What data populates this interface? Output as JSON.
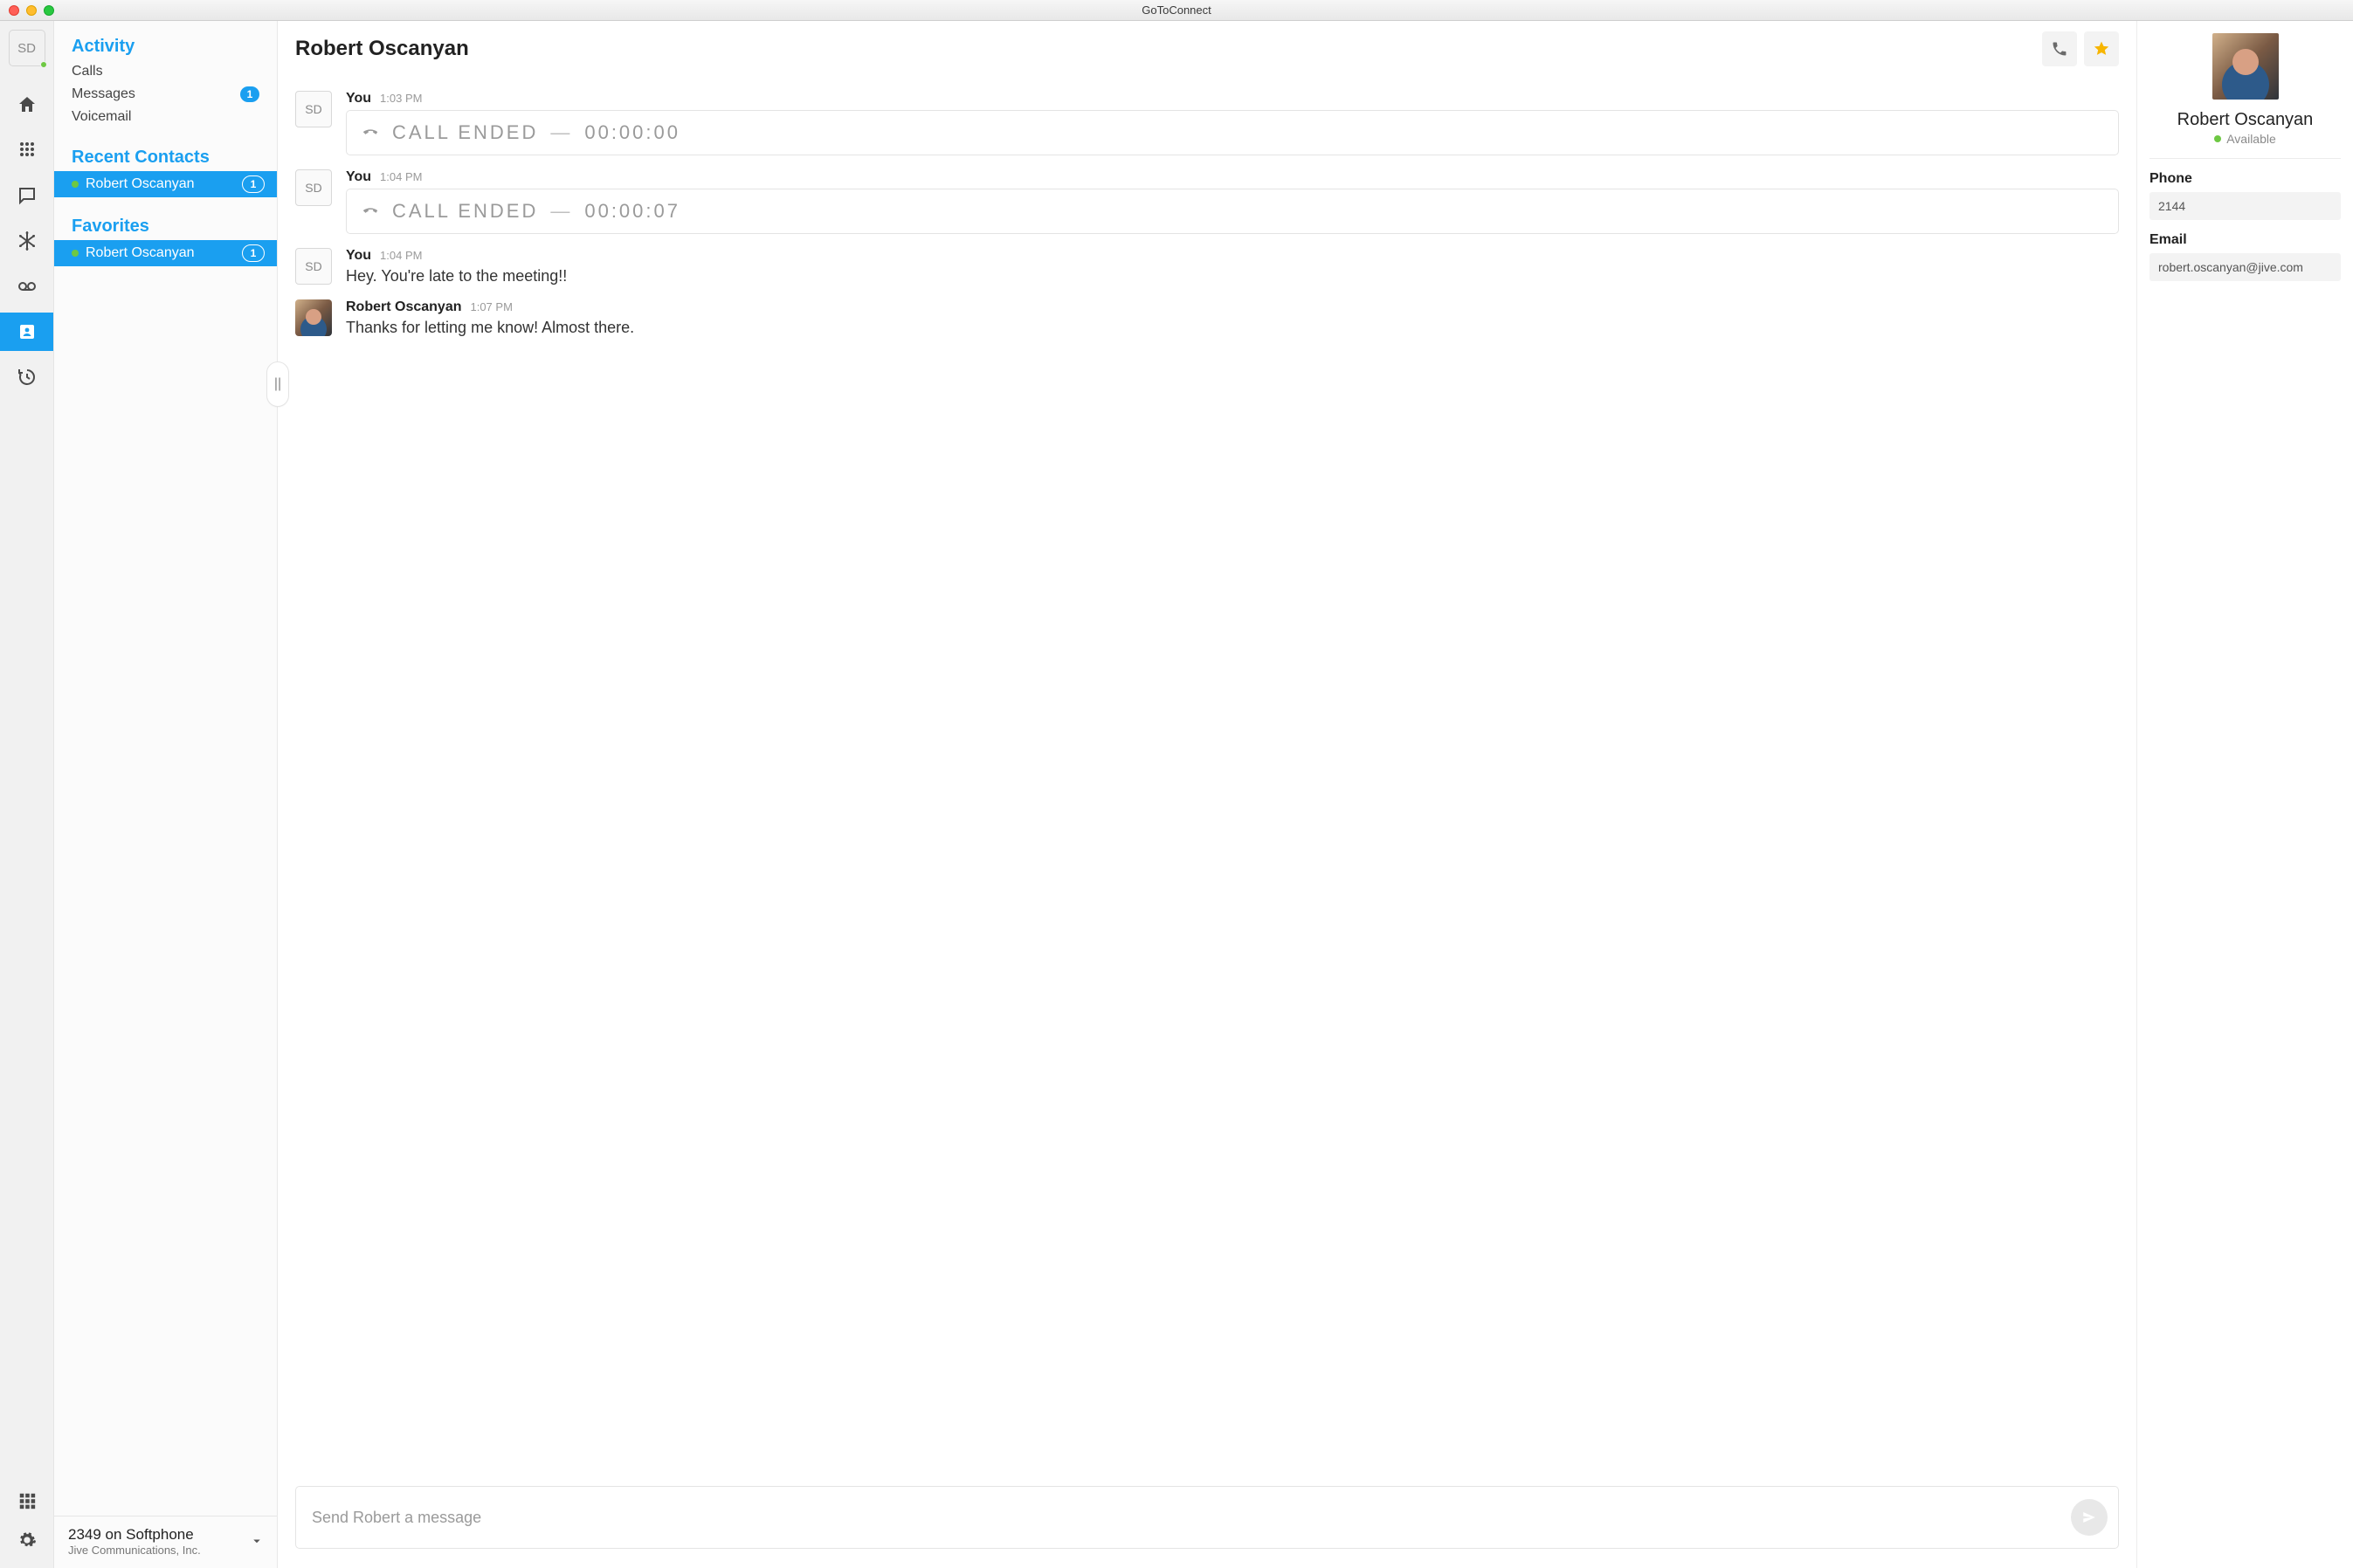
{
  "window": {
    "title": "GoToConnect"
  },
  "rail": {
    "user_initials": "SD"
  },
  "sidebar": {
    "activity": {
      "title": "Activity",
      "items": [
        {
          "label": "Calls"
        },
        {
          "label": "Messages",
          "badge": "1"
        },
        {
          "label": "Voicemail"
        }
      ]
    },
    "recent": {
      "title": "Recent Contacts",
      "items": [
        {
          "name": "Robert Oscanyan",
          "badge": "1"
        }
      ]
    },
    "favorites": {
      "title": "Favorites",
      "items": [
        {
          "name": "Robert Oscanyan",
          "badge": "1"
        }
      ]
    },
    "footer": {
      "primary": "2349 on Softphone",
      "secondary": "Jive Communications, Inc."
    }
  },
  "conversation": {
    "title": "Robert Oscanyan",
    "compose_placeholder": "Send Robert a message",
    "messages": [
      {
        "avatar": "SD",
        "who": "You",
        "time": "1:03 PM",
        "call_label": "CALL ENDED",
        "sep": "—",
        "duration": "00:00:00"
      },
      {
        "avatar": "SD",
        "who": "You",
        "time": "1:04 PM",
        "call_label": "CALL ENDED",
        "sep": "—",
        "duration": "00:00:07"
      },
      {
        "avatar": "SD",
        "who": "You",
        "time": "1:04 PM",
        "text": "Hey. You're late to the meeting!!"
      },
      {
        "who": "Robert Oscanyan",
        "time": "1:07 PM",
        "text": "Thanks for letting me know! Almost there."
      }
    ]
  },
  "info": {
    "name": "Robert Oscanyan",
    "presence": "Available",
    "phone_label": "Phone",
    "phone": "2144",
    "email_label": "Email",
    "email": "robert.oscanyan@jive.com"
  },
  "collapse_glyph": "||"
}
